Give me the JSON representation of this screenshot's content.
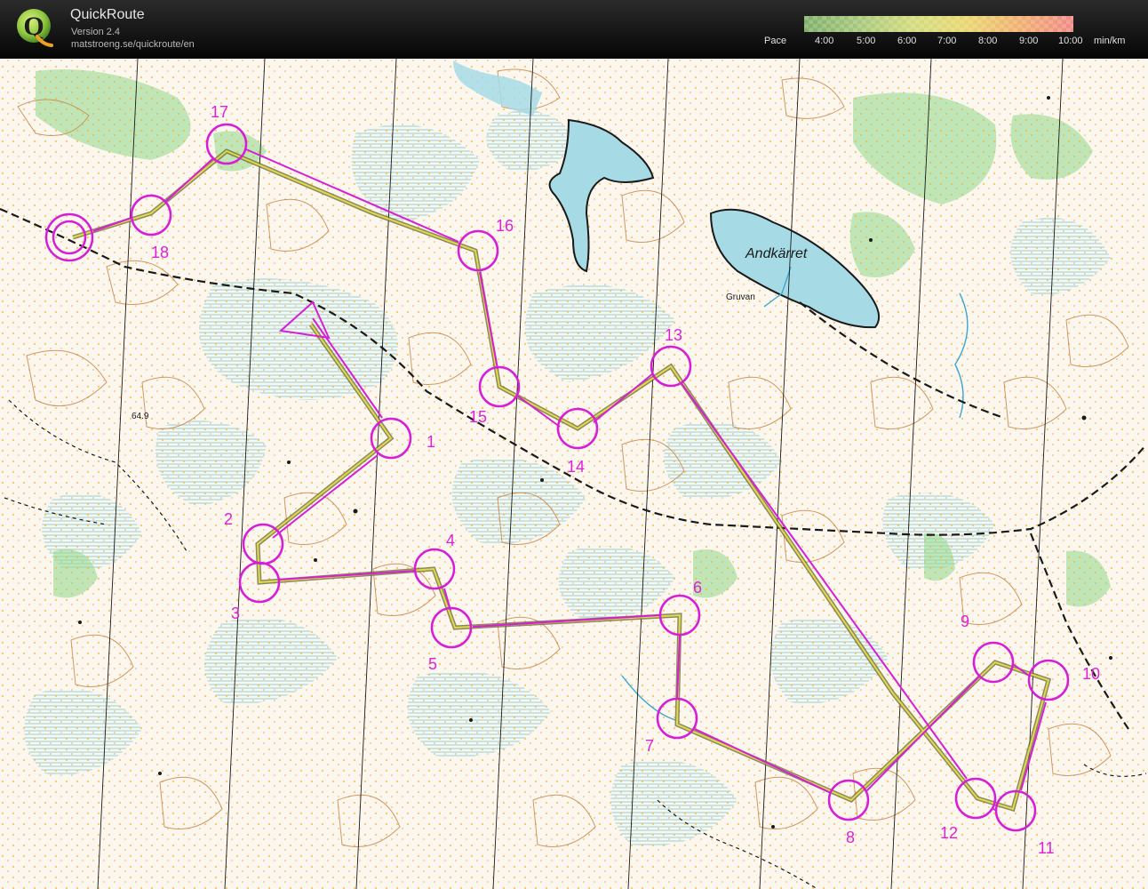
{
  "app": {
    "title": "QuickRoute",
    "version": "Version 2.4",
    "url": "matstroeng.se/quickroute/en",
    "logo_icon": "quickroute-q-logo"
  },
  "pace_legend": {
    "label": "Pace",
    "ticks": [
      "4:00",
      "5:00",
      "6:00",
      "7:00",
      "8:00",
      "9:00",
      "10:00"
    ],
    "unit": "min/km",
    "gradient_colors": [
      "#7fb06a",
      "#a6c77b",
      "#d2db7d",
      "#e9d770",
      "#f0b070",
      "#ef8a86"
    ]
  },
  "map": {
    "place_labels": {
      "lake": "Andkärret",
      "mine": "Gruvan",
      "height": "64.9"
    },
    "controls": [
      {
        "label": "1"
      },
      {
        "label": "2"
      },
      {
        "label": "3"
      },
      {
        "label": "4"
      },
      {
        "label": "5"
      },
      {
        "label": "6"
      },
      {
        "label": "7"
      },
      {
        "label": "8"
      },
      {
        "label": "9"
      },
      {
        "label": "10"
      },
      {
        "label": "11"
      },
      {
        "label": "12"
      },
      {
        "label": "13"
      },
      {
        "label": "14"
      },
      {
        "label": "15"
      },
      {
        "label": "16"
      },
      {
        "label": "17"
      },
      {
        "label": "18"
      }
    ],
    "course_color": "#d61ed8",
    "route_color": "#7f7a34"
  }
}
